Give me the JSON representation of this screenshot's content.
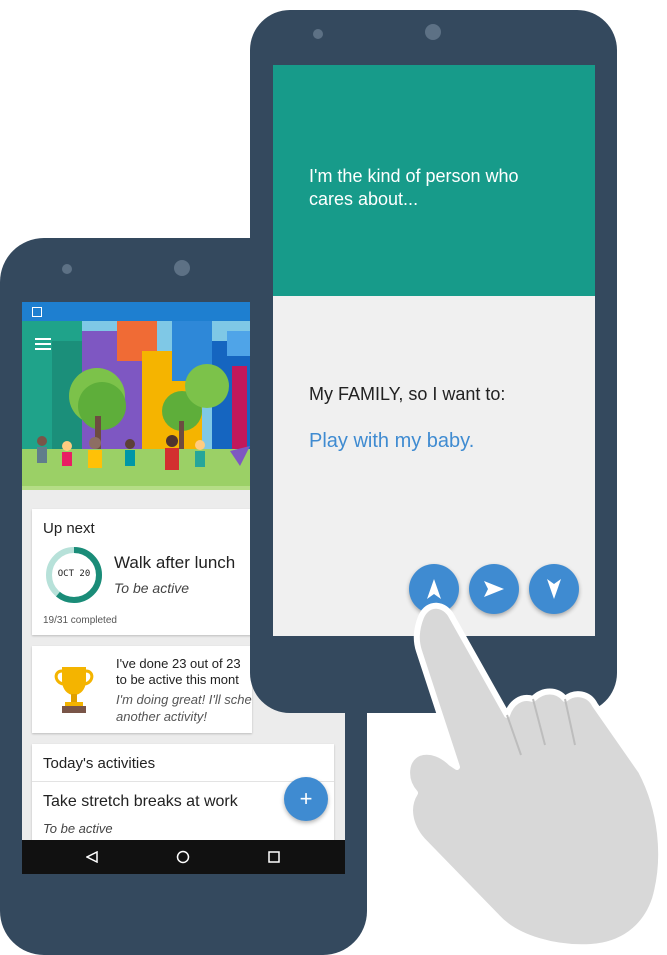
{
  "back_phone": {
    "up_next": {
      "heading": "Up next",
      "date_badge": "OCT 20",
      "progress_fraction": 0.61,
      "activity_title": "Walk after lunch",
      "activity_goal": "To be active",
      "completed": "19/31 completed"
    },
    "achievement": {
      "line1": "I've done 23 out of 23",
      "line2": "to be active this mont",
      "line3": "I'm doing great! I'll sche",
      "line4": "another activity!",
      "icon": "trophy-icon"
    },
    "today": {
      "heading": "Today's activities",
      "item_title": "Take stretch breaks at work",
      "item_goal": "To be active",
      "add_symbol": "+"
    },
    "nav": {
      "back_icon": "back-icon",
      "home_icon": "home-icon",
      "recents_icon": "recents-icon"
    }
  },
  "front_phone": {
    "prompt": "I'm the kind of person who cares about...",
    "statement": "My FAMILY, so I want to:",
    "selected_answer": "Play with my baby.",
    "buttons": [
      "up-arrow-icon",
      "send-icon",
      "down-arrow-icon"
    ]
  },
  "colors": {
    "phone_body": "#34495e",
    "teal": "#179b8a",
    "accent_blue": "#3f8bd1",
    "status_blue": "#1e7fd0",
    "progress_teal": "#1a8c78"
  }
}
